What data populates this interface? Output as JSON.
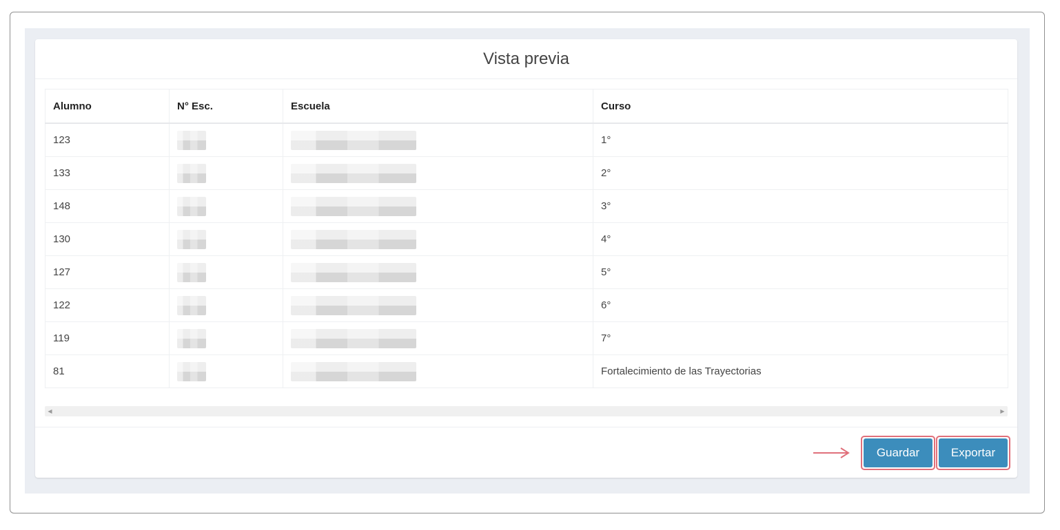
{
  "card": {
    "title": "Vista previa"
  },
  "table": {
    "columns": [
      "Alumno",
      "N° Esc.",
      "Escuela",
      "Curso"
    ],
    "rows": [
      {
        "alumno": "123",
        "curso": "1°"
      },
      {
        "alumno": "133",
        "curso": "2°"
      },
      {
        "alumno": "148",
        "curso": "3°"
      },
      {
        "alumno": "130",
        "curso": "4°"
      },
      {
        "alumno": "127",
        "curso": "5°"
      },
      {
        "alumno": "122",
        "curso": "6°"
      },
      {
        "alumno": "119",
        "curso": "7°"
      },
      {
        "alumno": "81",
        "curso": "Fortalecimiento de las Trayectorias"
      }
    ]
  },
  "footer": {
    "save_label": "Guardar",
    "export_label": "Exportar"
  },
  "colors": {
    "primary_button": "#3c8dbc",
    "highlight_border": "#e06f7a",
    "page_background": "#ebeef3"
  }
}
